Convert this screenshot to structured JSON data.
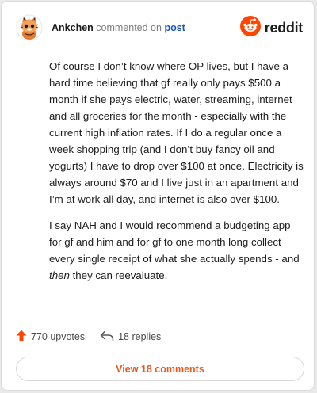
{
  "header": {
    "author": "Ankchen",
    "action": "commented on",
    "target": "post",
    "brand": "reddit",
    "avatar_icon": "snoo-cat-avatar-icon",
    "brand_icon": "reddit-logo-icon"
  },
  "comment": {
    "paragraph1": "Of course I don’t know where OP lives, but I have a hard time believing that gf really only pays $500 a month if she pays electric, water, streaming, internet and all groceries for the month - especially with the current high inflation rates. If I do a regular once a week shopping trip (and I don’t buy fancy oil and yogurts) I have to drop over $100 at once. Electricity is always around $70 and I live just in an apartment and I’m at work all day, and internet is also over $100.",
    "paragraph2_before": "I say NAH and I would recommend a budgeting app for gf and him and for gf to one month long collect every single receipt of what she actually spends - and ",
    "paragraph2_emphasis": "then",
    "paragraph2_after": " they can reevaluate."
  },
  "stats": {
    "upvotes": "770 upvotes",
    "replies": "18 replies"
  },
  "view_button": "View 18 comments",
  "colors": {
    "upvote": "#ff4500",
    "link": "#1a55c0",
    "brand": "#ff4500",
    "view_button_text": "#e85a1a"
  }
}
